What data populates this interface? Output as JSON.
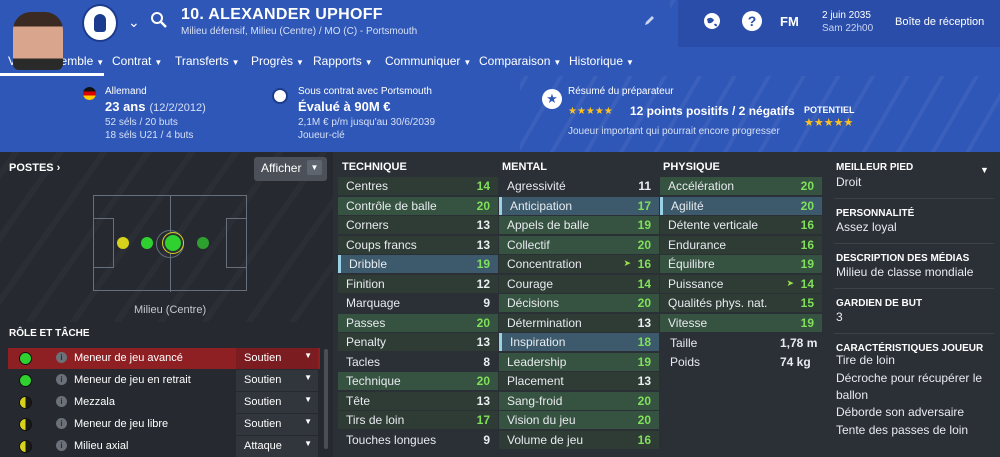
{
  "header": {
    "player_title": "10. ALEXANDER UPHOFF",
    "subtitle": "Milieu défensif, Milieu (Centre) / MO (C) - Portsmouth",
    "game_logo": "FM",
    "date": "2 juin 2035",
    "day_time": "Sam 22h00",
    "inbox_label": "Boîte de réception",
    "help_label": "?"
  },
  "nav": {
    "items": [
      {
        "label": "Vue d'ensemble"
      },
      {
        "label": "Contrat"
      },
      {
        "label": "Transferts"
      },
      {
        "label": "Progrès"
      },
      {
        "label": "Rapports"
      },
      {
        "label": "Communiquer"
      },
      {
        "label": "Comparaison"
      },
      {
        "label": "Historique"
      }
    ],
    "active": "Vue d'ensemble"
  },
  "profile": {
    "nationality": "Allemand",
    "age": "23 ans",
    "dob": "(12/2/2012)",
    "caps_senior": "52 séls / 20 buts",
    "caps_u21": "18 séls U21 / 4 buts",
    "contract_label": "Sous contrat avec Portsmouth",
    "value": "Évalué à 90M €",
    "wage": "2,1M € p/m jusqu'au 30/6/2039",
    "squad_status": "Joueur-clé",
    "coach_label": "Résumé du préparateur",
    "coach_stars": "★★★★★",
    "coach_summary": "12 points positifs / 2 négatifs",
    "coach_note": "Joueur important qui pourrait encore progresser",
    "potential_label": "POTENTIEL",
    "potential_stars": "★★★★★"
  },
  "positions": {
    "title": "POSTES ›",
    "show_button": "Afficher",
    "caption": "Milieu (Centre)",
    "dots": [
      {
        "color": "#d7d21c"
      },
      {
        "color": "#2fd12f"
      },
      {
        "color": "#2fd12f"
      },
      {
        "color": "#2ea02e"
      }
    ]
  },
  "roles": {
    "title": "RÔLE ET TÂCHE",
    "items": [
      {
        "name": "Meneur de jeu avancé",
        "duty": "Soutien",
        "dot": "#2fd12f"
      },
      {
        "name": "Meneur de jeu en retrait",
        "duty": "Soutien",
        "dot": "#2fd12f"
      },
      {
        "name": "Mezzala",
        "duty": "Soutien",
        "dot": "#d7d21c"
      },
      {
        "name": "Meneur de jeu libre",
        "duty": "Soutien",
        "dot": "#d7d21c"
      },
      {
        "name": "Milieu axial",
        "duty": "Attaque",
        "dot": "#d7d21c"
      }
    ]
  },
  "technique": {
    "title": "TECHNIQUE",
    "rows": [
      {
        "name": "Centres",
        "value": "14"
      },
      {
        "name": "Contrôle de balle",
        "value": "20"
      },
      {
        "name": "Corners",
        "value": "13"
      },
      {
        "name": "Coups francs",
        "value": "13"
      },
      {
        "name": "Dribble",
        "value": "19"
      },
      {
        "name": "Finition",
        "value": "12"
      },
      {
        "name": "Marquage",
        "value": "9"
      },
      {
        "name": "Passes",
        "value": "20"
      },
      {
        "name": "Penalty",
        "value": "13"
      },
      {
        "name": "Tacles",
        "value": "8"
      },
      {
        "name": "Technique",
        "value": "20"
      },
      {
        "name": "Tête",
        "value": "13"
      },
      {
        "name": "Tirs de loin",
        "value": "17"
      },
      {
        "name": "Touches longues",
        "value": "9"
      }
    ]
  },
  "mental": {
    "title": "MENTAL",
    "rows": [
      {
        "name": "Agressivité",
        "value": "11"
      },
      {
        "name": "Anticipation",
        "value": "17"
      },
      {
        "name": "Appels de balle",
        "value": "19"
      },
      {
        "name": "Collectif",
        "value": "20"
      },
      {
        "name": "Concentration",
        "value": "16"
      },
      {
        "name": "Courage",
        "value": "14"
      },
      {
        "name": "Décisions",
        "value": "20"
      },
      {
        "name": "Détermination",
        "value": "13"
      },
      {
        "name": "Inspiration",
        "value": "18"
      },
      {
        "name": "Leadership",
        "value": "19"
      },
      {
        "name": "Placement",
        "value": "13"
      },
      {
        "name": "Sang-froid",
        "value": "20"
      },
      {
        "name": "Vision du jeu",
        "value": "20"
      },
      {
        "name": "Volume de jeu",
        "value": "16"
      }
    ]
  },
  "physique": {
    "title": "PHYSIQUE",
    "rows": [
      {
        "name": "Accélération",
        "value": "20"
      },
      {
        "name": "Agilité",
        "value": "20"
      },
      {
        "name": "Détente verticale",
        "value": "16"
      },
      {
        "name": "Endurance",
        "value": "16"
      },
      {
        "name": "Équilibre",
        "value": "19"
      },
      {
        "name": "Puissance",
        "value": "14"
      },
      {
        "name": "Qualités phys. nat.",
        "value": "15"
      },
      {
        "name": "Vitesse",
        "value": "19"
      }
    ],
    "height_label": "Taille",
    "height_value": "1,78 m",
    "weight_label": "Poids",
    "weight_value": "74 kg"
  },
  "info": {
    "foot_title": "MEILLEUR PIED",
    "foot_value": "Droit",
    "personality_title": "PERSONNALITÉ",
    "personality_value": "Assez loyal",
    "media_title": "DESCRIPTION DES MÉDIAS",
    "media_value": "Milieu de classe mondiale",
    "gk_title": "GARDIEN DE BUT",
    "gk_value": "3",
    "traits_title": "CARACTÉRISTIQUES JOUEUR",
    "traits": [
      "Tire de loin",
      "Décroche pour récupérer le ballon",
      "Déborde son adversaire",
      "Tente des passes de loin"
    ]
  },
  "colors": {
    "header_blue": "#2f57b8",
    "panel_dark": "#2b2f36",
    "value_green": "#7fe05a",
    "selected_role": "#8e2024",
    "star_gold": "#ffc21b"
  }
}
